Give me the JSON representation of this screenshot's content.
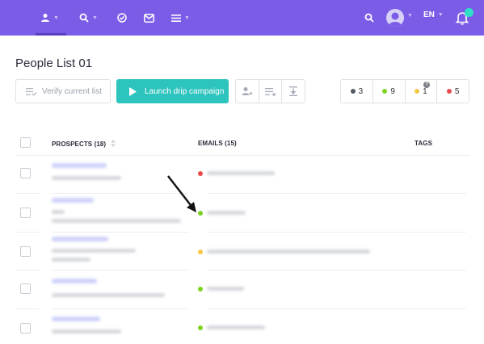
{
  "topbar": {
    "icons": [
      "person-icon",
      "search-icon",
      "check-circle-icon",
      "mail-icon",
      "menu-icon"
    ],
    "language": "EN"
  },
  "page": {
    "title": "People List 01"
  },
  "toolbar": {
    "verify_label": "Verify current list",
    "launch_label": "Launch drip campaign",
    "icon_buttons": [
      "add-person-icon",
      "add-to-list-icon",
      "download-icon"
    ]
  },
  "status_counts": [
    {
      "name": "unverified",
      "count": "3",
      "color": "#555b66"
    },
    {
      "name": "valid",
      "count": "9",
      "color": "#7ed321"
    },
    {
      "name": "risky",
      "count": "1",
      "color": "#f5c842",
      "badge": "?"
    },
    {
      "name": "invalid",
      "count": "5",
      "color": "#e94b4b"
    }
  ],
  "table": {
    "headers": {
      "prospects": "PROSPECTS (18)",
      "emails": "EMAILS (15)",
      "tags": "TAGS"
    },
    "rows": [
      {
        "email_status_color": "#e94b4b"
      },
      {
        "email_status_color": "#7ed321"
      },
      {
        "email_status_color": "#f5c842"
      },
      {
        "email_status_color": "#7ed321"
      },
      {
        "email_status_color": "#7ed321"
      }
    ]
  },
  "annotation": {
    "arrow_color": "#111111"
  }
}
